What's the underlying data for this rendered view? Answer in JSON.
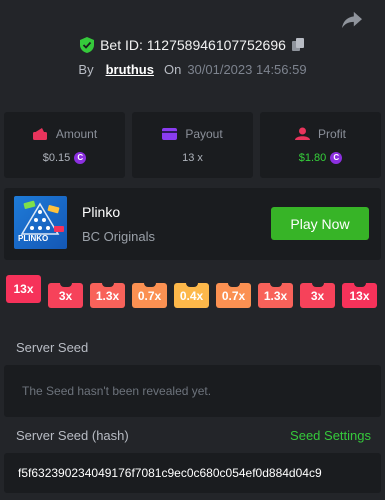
{
  "header": {
    "bet_id_label": "Bet ID: 112758946107752696",
    "by_label": "By",
    "username": "bruthus",
    "on_label": "On",
    "datetime": "30/01/2023 14:56:59"
  },
  "stats": [
    {
      "title": "Amount",
      "value": "$0.15",
      "coin": "C",
      "icon": "wallet-icon",
      "icon_color": "#e8345c"
    },
    {
      "title": "Payout",
      "value": "13 x",
      "icon": "card-icon",
      "icon_color": "#8a3cf0"
    },
    {
      "title": "Profit",
      "value": "$1.80",
      "coin": "C",
      "icon": "profit-icon",
      "icon_color": "#e8345c",
      "value_color": "#35d03a"
    }
  ],
  "game": {
    "name": "Plinko",
    "provider": "BC Originals",
    "thumb_label": "PLINKO",
    "play_label": "Play Now"
  },
  "multipliers": [
    {
      "label": "13x",
      "color": "#f6325a"
    },
    {
      "label": "3x",
      "color": "#f6425a"
    },
    {
      "label": "1.3x",
      "color": "#f8625a"
    },
    {
      "label": "0.7x",
      "color": "#fb9152"
    },
    {
      "label": "0.4x",
      "color": "#fdb84a"
    },
    {
      "label": "0.7x",
      "color": "#fb9152"
    },
    {
      "label": "1.3x",
      "color": "#f8625a"
    },
    {
      "label": "3x",
      "color": "#f6425a"
    },
    {
      "label": "13x",
      "color": "#f6325a"
    }
  ],
  "server_seed": {
    "label": "Server Seed",
    "value": "The Seed hasn't been revealed yet."
  },
  "server_seed_hash": {
    "label": "Server Seed (hash)",
    "settings_label": "Seed Settings",
    "value": "f5f632390234049176f7081c9ec0c680c054ef0d884d04c9"
  }
}
